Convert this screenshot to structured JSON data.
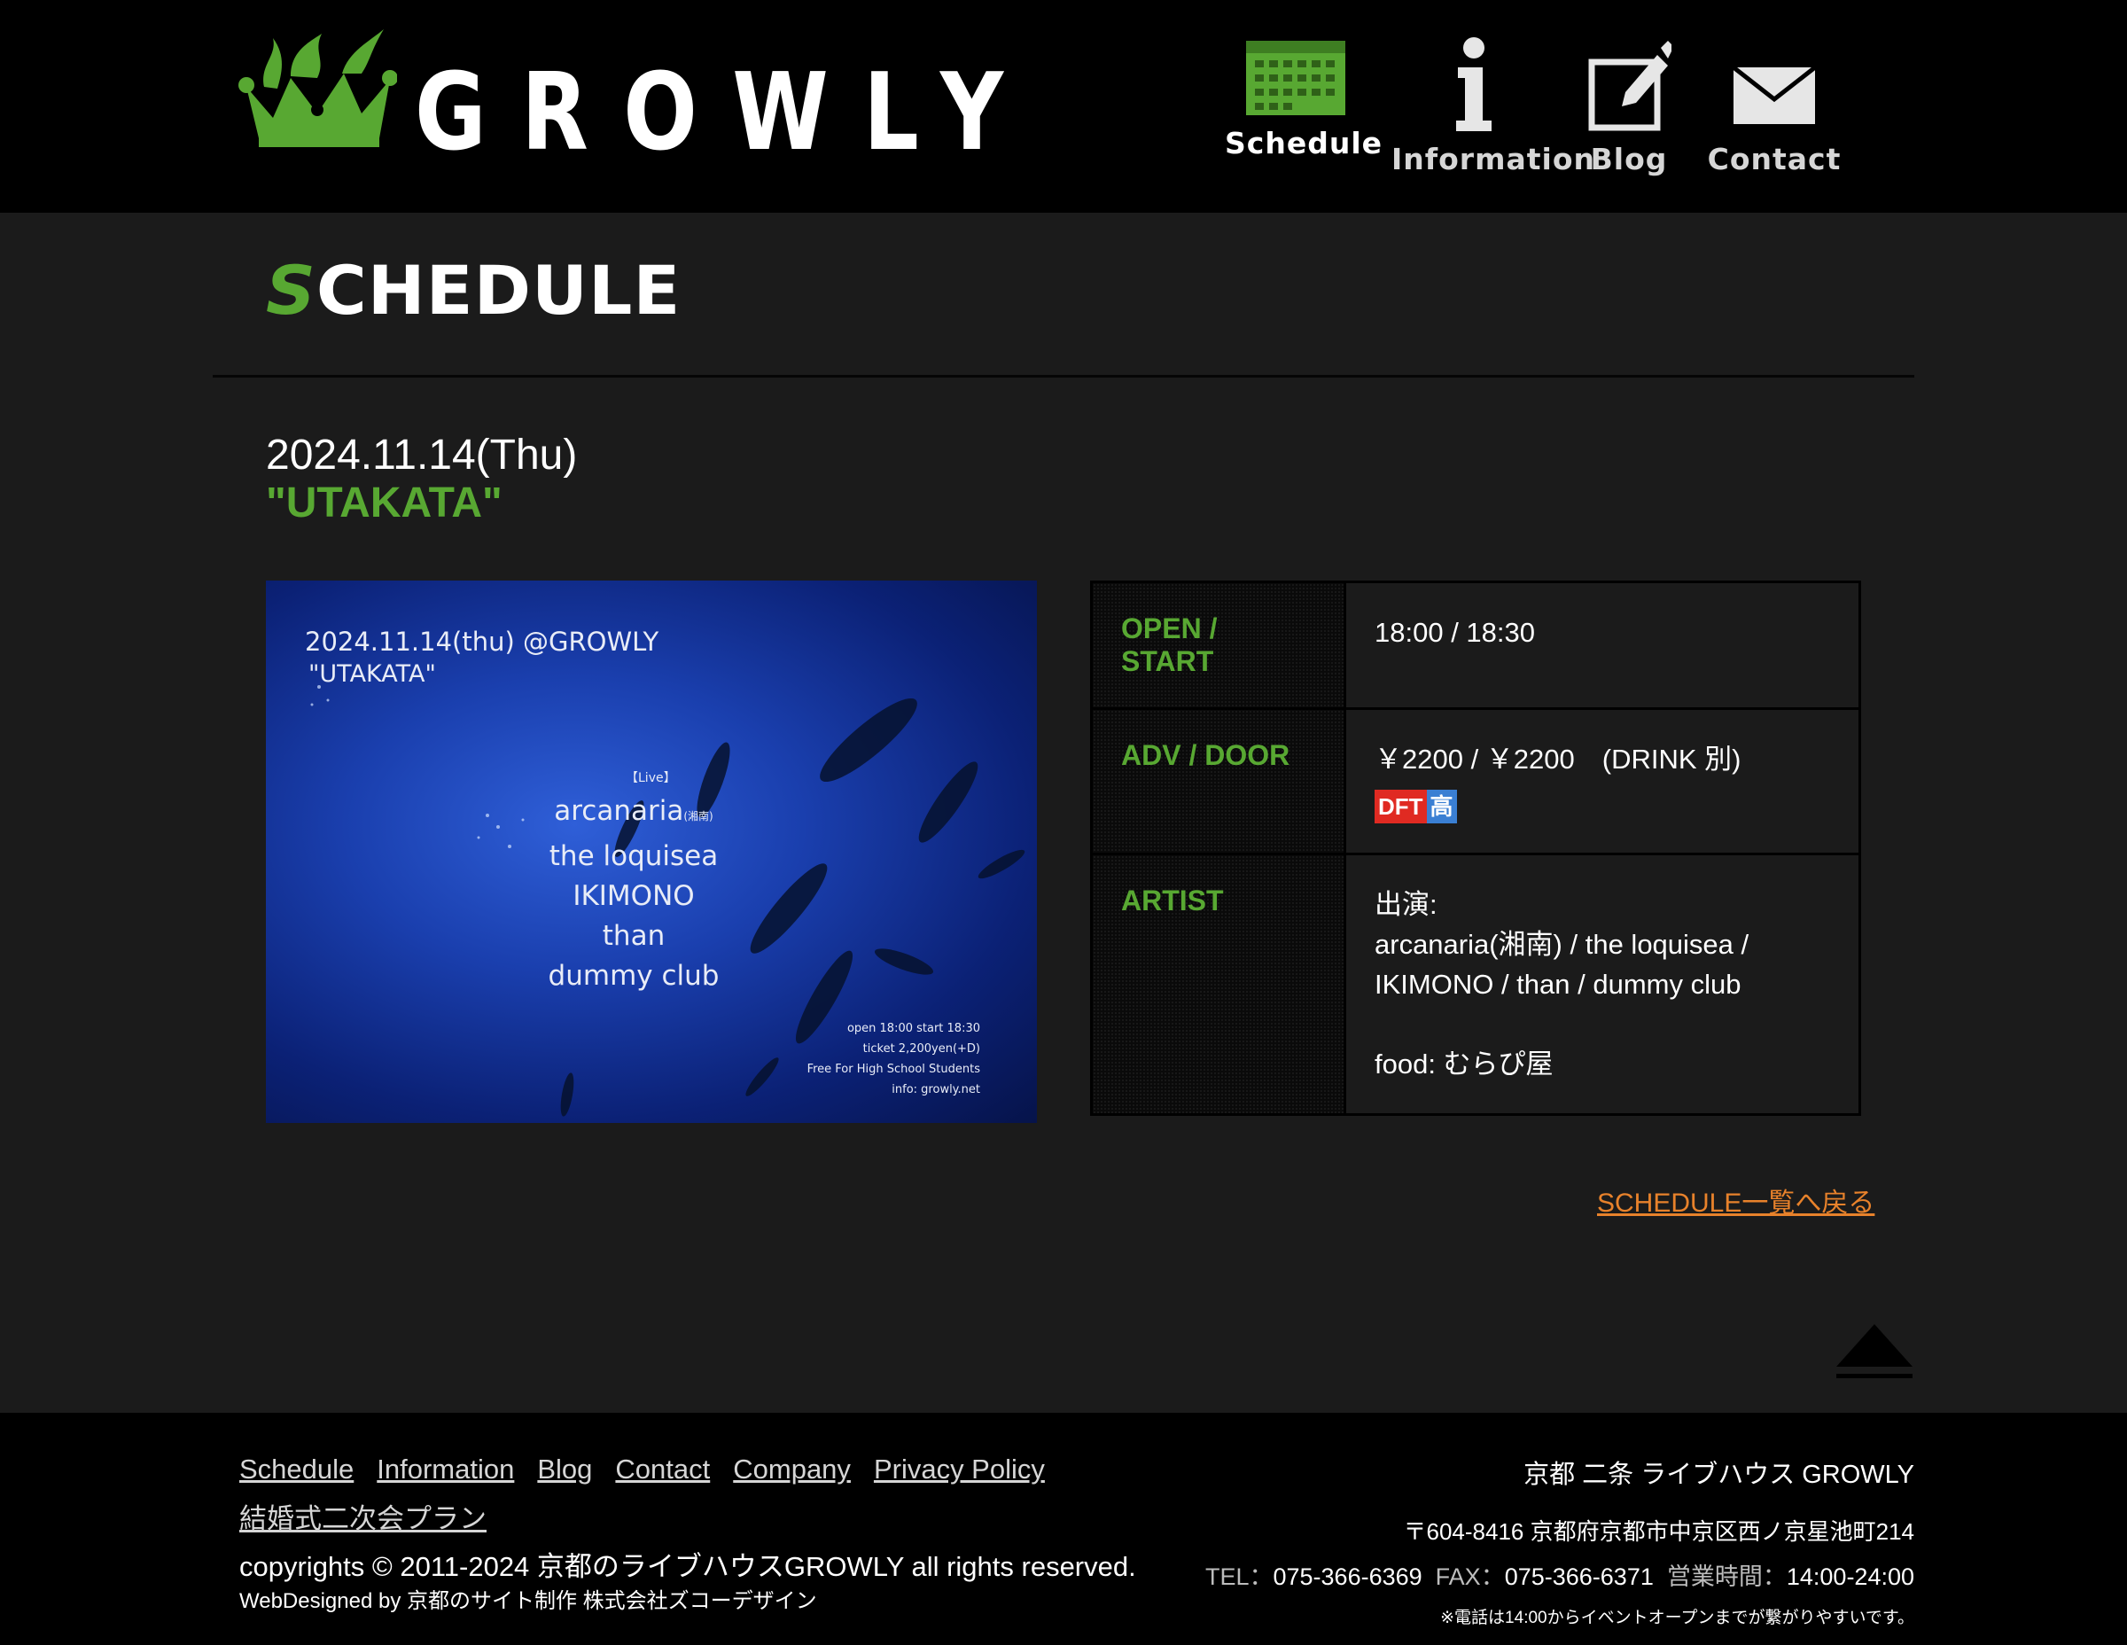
{
  "header": {
    "logo_text": "GROWLY",
    "nav": [
      {
        "label": "Schedule",
        "icon": "calendar-icon",
        "active": true
      },
      {
        "label": "Information",
        "icon": "info-icon"
      },
      {
        "label": "Blog",
        "icon": "edit-pencil-icon"
      },
      {
        "label": "Contact",
        "icon": "mail-icon"
      }
    ]
  },
  "page": {
    "title_first": "S",
    "title_rest": "CHEDULE"
  },
  "event": {
    "date": "2024.11.14(Thu)",
    "title": "\"UTAKATA\"",
    "flyer": {
      "line1": "2024.11.14(thu) @GROWLY",
      "line2": "\"UTAKATA\"",
      "live_tag": "【Live】",
      "artists": [
        "arcanaria",
        "the loquisea",
        "IKIMONO",
        "than",
        "dummy club"
      ],
      "arcanaria_sub": "(湘南)",
      "details": [
        "open 18:00 start 18:30",
        "ticket 2,200yen(+D)",
        "Free For High School Students",
        "info: growly.net"
      ]
    },
    "table": {
      "open_label": "OPEN / START",
      "open_value": "18:00 / 18:30",
      "adv_label": "ADV / DOOR",
      "adv_value": "￥2200 / ￥2200　(DRINK 別)",
      "badge_dft": "DFT",
      "badge_hs": "高",
      "artist_label": "ARTIST",
      "artist_line1": "出演:",
      "artist_line2": "arcanaria(湘南) / the loquisea /",
      "artist_line3": "IKIMONO / than / dummy club",
      "artist_food": "food: むらぴ屋"
    },
    "back_link": "SCHEDULE一覧へ戻る"
  },
  "footer": {
    "links": [
      "Schedule",
      "Information",
      "Blog",
      "Contact",
      "Company",
      "Privacy Policy",
      "結婚式二次会プラン"
    ],
    "copyright": "copyrights © 2011-2024 京都のライブハウスGROWLY all rights reserved.",
    "webdesigned": "WebDesigned by 京都のサイト制作 株式会社ズコーデザイン",
    "venue_name": "京都 二条 ライブハウス GROWLY",
    "postal": "〒604-8416 京都府京都市中京区西ノ京星池町214",
    "tel_label": "TEL：",
    "tel": "075-366-6369",
    "fax_label": "FAX：",
    "fax": "075-366-6371",
    "hours_label": "営業時間：",
    "hours": "14:00-24:00",
    "note": "※電話は14:00からイベントオープンまでが繋がりやすいです。"
  },
  "colors": {
    "accent_green": "#58a832",
    "link_orange": "#e8822b",
    "background": "#1b1b1b",
    "header_bg": "#000000"
  }
}
